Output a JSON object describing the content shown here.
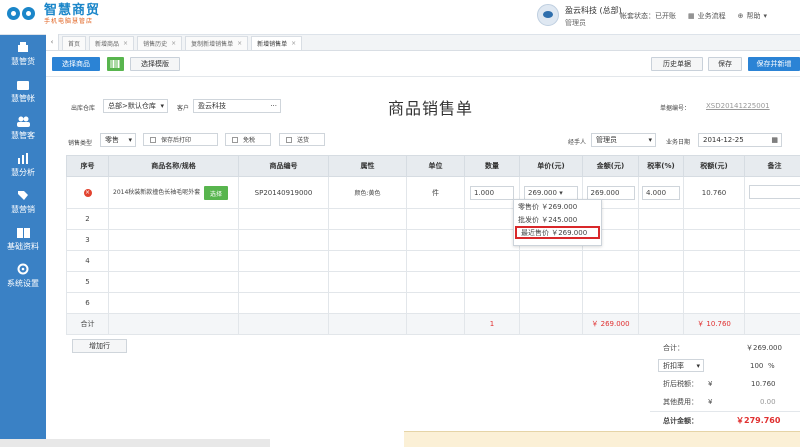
{
  "brand": {
    "title": "智慧商贸",
    "subtitle": "手机电脑慧管店"
  },
  "header": {
    "company": "盈云科技 (总部)",
    "role": "管理员",
    "account_status": "帐套状态：已开账",
    "business_flow": "业务流程",
    "help": "帮助"
  },
  "sidebar": [
    "慧管货",
    "慧管帐",
    "慧管客",
    "慧分析",
    "慧营销",
    "基础资料",
    "系统设置"
  ],
  "tabs": [
    "首页",
    "新增商品",
    "销售历史",
    "复制新增销售单",
    "新增销售单"
  ],
  "toolbar": {
    "select_goods": "选择商品",
    "select_template": "选择模版",
    "history": "历史单据",
    "save": "保存",
    "save_new": "保存并新增"
  },
  "form": {
    "warehouse_label": "出库仓库",
    "warehouse_value": "总部>默认仓库",
    "customer_label": "客户",
    "customer_value": "盈云科技",
    "page_title": "商品销售单",
    "order_no_label": "单据编号：",
    "order_no": "XSD20141225001",
    "sale_type_label": "销售类型",
    "sale_type_value": "零售",
    "print_after_save": "保存后打印",
    "tax_free": "免税",
    "deliver": "送货",
    "handler_label": "经手人",
    "handler_value": "管理员",
    "date_label": "业务日期",
    "date_value": "2014-12-25"
  },
  "table": {
    "headers": [
      "序号",
      "商品名称/规格",
      "商品编号",
      "属性",
      "单位",
      "数量",
      "单价(元)",
      "金额(元)",
      "税率(%)",
      "税额(元)",
      "备注"
    ],
    "row1": {
      "name": "2014秋装新款撞色长袖毛呢外套",
      "select": "选择",
      "code": "SP20140919000",
      "attr": "颜色:黄色",
      "unit": "件",
      "qty": "1.000",
      "price": "269.000",
      "amount": "269.000",
      "tax_rate": "4.000",
      "tax": "10.760"
    },
    "rows": [
      "2",
      "3",
      "4",
      "5",
      "6"
    ],
    "sum": {
      "label": "合计",
      "qty": "1",
      "amount": "￥ 269.000",
      "tax": "￥ 10.760"
    }
  },
  "price_dropdown": [
    "零售价 ￥269.000",
    "批发价 ￥245.000",
    "最近售价 ￥269.000"
  ],
  "add_row": "增加行",
  "totals": {
    "subtotal_label": "合计：",
    "subtotal": "￥269.000",
    "discount_type": "折扣率",
    "discount_value": "100",
    "percent": "%",
    "after_discount_label": "折后税额：",
    "after_discount_symbol": "¥",
    "after_discount": "10.760",
    "other_fee_label": "其他费用：",
    "other_fee_symbol": "¥",
    "other_fee": "0.00",
    "grand_label": "总计金额：",
    "grand_total": "￥279.760"
  }
}
